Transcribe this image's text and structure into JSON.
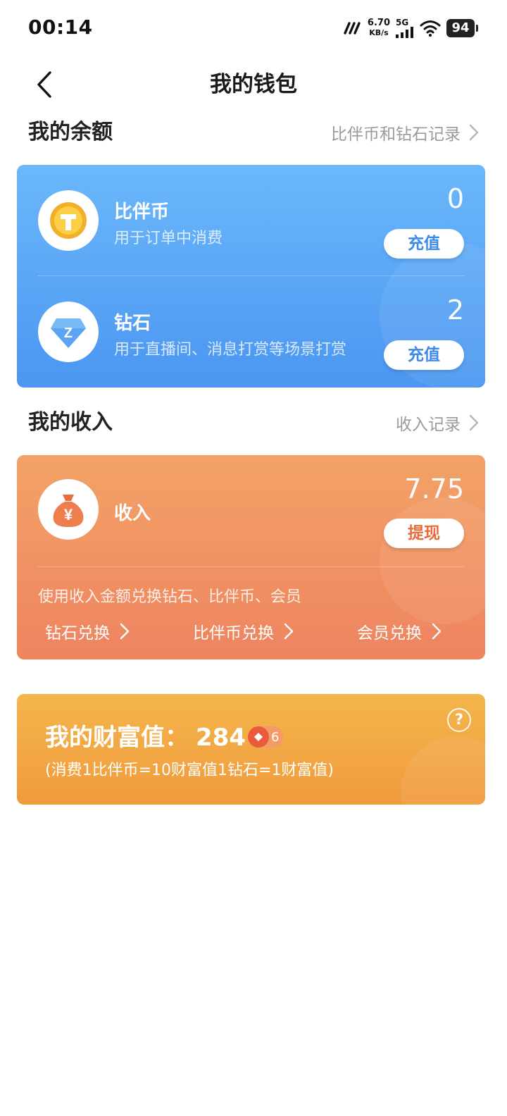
{
  "status_bar": {
    "time": "00:14",
    "net_speed": "6.70",
    "net_speed_unit": "KB/s",
    "network": "5G",
    "battery": "94"
  },
  "nav": {
    "title": "我的钱包",
    "back_icon": "chevron-left-icon"
  },
  "balance": {
    "title": "我的余额",
    "record_link": "比伴币和钻石记录",
    "coin": {
      "name": "比伴币",
      "desc": "用于订单中消费",
      "value": "0",
      "button": "充值",
      "icon": "gold-coin-icon"
    },
    "diamond": {
      "name": "钻石",
      "desc": "用于直播间、消息打赏等场景打赏",
      "value": "2",
      "button": "充值",
      "icon": "diamond-icon",
      "icon_letter": "Z"
    }
  },
  "income": {
    "title": "我的收入",
    "record_link": "收入记录",
    "label": "收入",
    "value": "7.75",
    "button": "提现",
    "icon": "money-bag-icon",
    "icon_symbol": "¥",
    "note": "使用收入金额兑换钻石、比伴币、会员",
    "exchanges": [
      "钻石兑换",
      "比伴币兑换",
      "会员兑换"
    ]
  },
  "wealth": {
    "label": "我的财富值：",
    "value": "284",
    "level": "6",
    "note": "(消费1比伴币=10财富值1钻石=1财富值)",
    "help": "?"
  },
  "colors": {
    "balance_card": "#4b96f1",
    "income_card": "#ee8460",
    "wealth_card": "#f09a3c",
    "button_blue_text": "#3d8be8",
    "button_orange_text": "#ea6b3c"
  }
}
